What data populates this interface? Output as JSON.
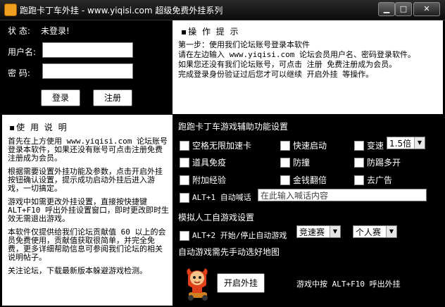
{
  "window": {
    "title": "跑跑卡丁车外挂 - www.yiqisi.com 超级免费外挂系列",
    "controls": {
      "minimize": "▁",
      "maximize": "□",
      "close": "✕"
    }
  },
  "login": {
    "status_label": "状  态:",
    "status_value": "未登录!",
    "username_label": "用户名:",
    "password_label": "密  码:",
    "username_value": "",
    "password_value": "",
    "login_button": "登录",
    "register_button": "注册"
  },
  "tips": {
    "header": "▪操 作 提 示",
    "lines": [
      "第一步：使用我们论坛账号登录本软件",
      "请在左边输入 www.yiqisi.com 论坛会员用户名、密码登录软件。",
      "如果您还没有我们论坛账号，可点击 注册 免费注册成为会员。",
      "完成登录身份验证过后您才可以继续 开启外挂 等操作。"
    ]
  },
  "manual": {
    "header": "▪使 用 说 明",
    "paragraphs": [
      "首先在上方使用 www.yiqisi.com 论坛账号登录本软件，如果还没有账号可点击注册免费注册成为会员。",
      "根据需要设置外挂功能及参数，点击开启外挂按钮确认设置，提示成功启动外挂后进入游戏，一切搞定。",
      "游戏中如需更改外挂设置，直接按快捷键 ALT+F10 呼出外挂设置窗口，即时更改即时生效无需退出游戏。",
      "本软件仅提供给我们论坛贡献值 60 以上的会员免费使用，贡献值获取很简单，并完全免费，更多详细帮助信息可参阅我们论坛的相关说明帖子。",
      "关注论坛，下载最新版本躲避游戏检测。"
    ]
  },
  "settings": {
    "section1_title": "跑跑卡丁车游戏辅助功能设置",
    "options": [
      {
        "label": "空格无限加速卡",
        "checked": false
      },
      {
        "label": "快速启动",
        "checked": false
      },
      {
        "label": "变速",
        "checked": false
      },
      {
        "label": "道具免疫",
        "checked": false
      },
      {
        "label": "防撞",
        "checked": false
      },
      {
        "label": "防踢多开",
        "checked": false
      },
      {
        "label": "附加经验",
        "checked": false
      },
      {
        "label": "金钱翻倍",
        "checked": false
      },
      {
        "label": "去广告",
        "checked": false
      }
    ],
    "speed_select": "1.5倍",
    "shout_label": "ALT+1 自动喊话",
    "shout_placeholder": "在此输入喊话内容",
    "section2_title": "模拟人工自游戏设置",
    "auto_label": "ALT+2 开始/停止自动游戏",
    "mode_select": "竞速赛",
    "team_select": "个人赛",
    "auto_note": "自动游戏需先手动选好地图",
    "start_button": "开启外挂",
    "hotkey_note": "游戏中按 ALT+F10 呼出外挂"
  }
}
